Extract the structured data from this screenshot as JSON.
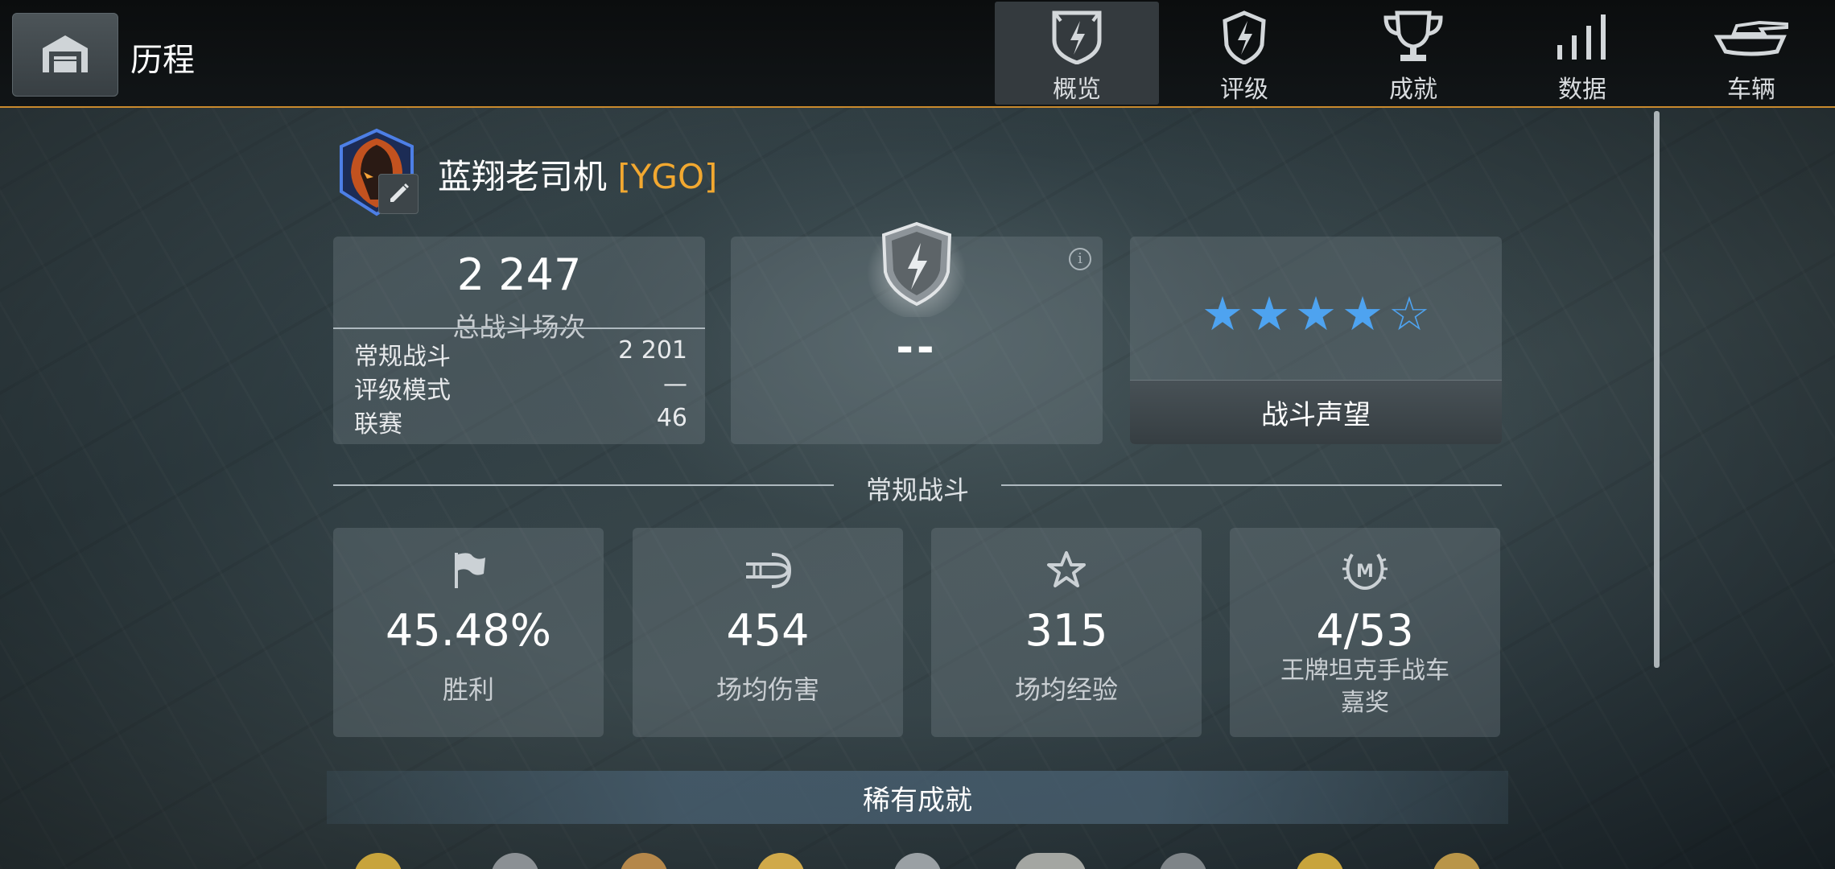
{
  "header": {
    "page_title": "历程",
    "tabs": [
      {
        "label": "概览",
        "icon": "shield-lightning-icon",
        "active": true
      },
      {
        "label": "评级",
        "icon": "rating-badge-icon",
        "active": false
      },
      {
        "label": "成就",
        "icon": "trophy-icon",
        "active": false
      },
      {
        "label": "数据",
        "icon": "bar-signal-icon",
        "active": false
      },
      {
        "label": "车辆",
        "icon": "tank-icon",
        "active": false
      }
    ]
  },
  "profile": {
    "name": "蓝翔老司机",
    "clan_tag": "[YGO]"
  },
  "battles": {
    "total": "2 247",
    "caption": "总战斗场次",
    "rows": [
      {
        "label": "常规战斗",
        "value": "2 201"
      },
      {
        "label": "评级模式",
        "value": "—"
      },
      {
        "label": "联赛",
        "value": "46"
      }
    ]
  },
  "rating": {
    "value": "--",
    "info_icon": "i"
  },
  "reputation": {
    "stars_filled": 4,
    "stars_total": 5,
    "button_label": "战斗声望"
  },
  "regular_section": {
    "title": "常规战斗",
    "stats": [
      {
        "value": "45.48%",
        "label": "胜利",
        "icon": "flag-icon"
      },
      {
        "value": "454",
        "label": "场均伤害",
        "icon": "shell-icon"
      },
      {
        "value": "315",
        "label": "场均经验",
        "icon": "star-outline-icon"
      },
      {
        "value": "4/53",
        "label_line1": "王牌坦克手战车",
        "label_line2": "嘉奖",
        "icon": "mastery-laurel-icon"
      }
    ]
  },
  "rare_achievements": {
    "title": "稀有成就"
  },
  "colors": {
    "accent_orange": "#f2a830",
    "star_blue": "#4ea3f0",
    "topbar_border": "#c98a2d"
  }
}
